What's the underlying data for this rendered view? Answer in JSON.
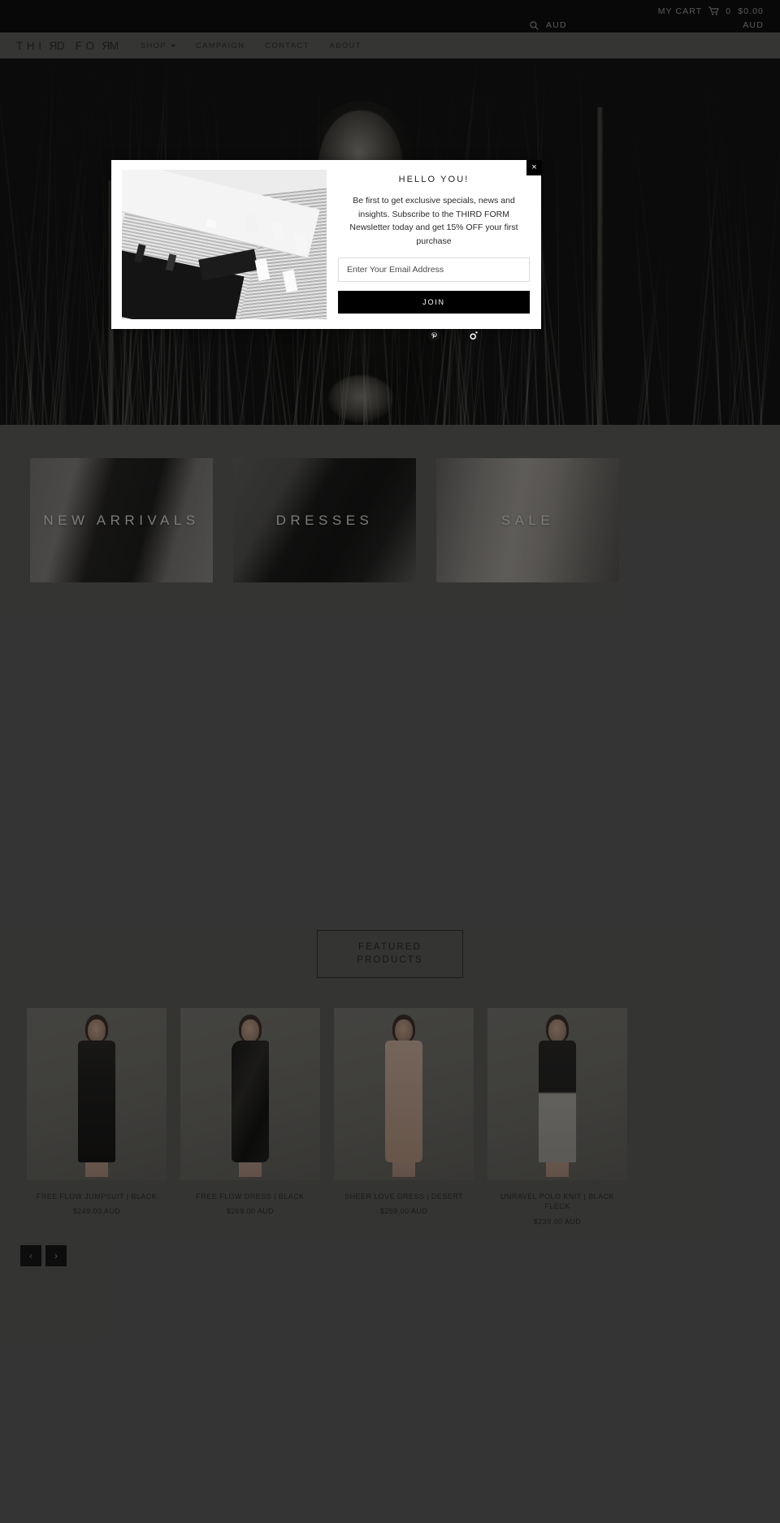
{
  "topbar": {
    "my_cart": "MY CART",
    "cart_icon": "shopping-cart-icon",
    "cart_count": "0",
    "cart_total": "$0.00",
    "search_icon": "search-icon",
    "currency_left": "AUD",
    "currency_right": "AUD"
  },
  "header": {
    "logo": "THIRD FORM",
    "logo_part_1": "THI",
    "logo_flip_1": "R",
    "logo_part_2": "D FO",
    "logo_flip_2": "R",
    "logo_part_3": "M",
    "nav": [
      {
        "label": "SHOP",
        "has_caret": true
      },
      {
        "label": "CAMPAIGN",
        "has_caret": false
      },
      {
        "label": "CONTACT",
        "has_caret": false
      },
      {
        "label": "ABOUT",
        "has_caret": false
      }
    ]
  },
  "categories": [
    {
      "label": "NEW ARRIVALS"
    },
    {
      "label": "DRESSES"
    },
    {
      "label": "SALE"
    }
  ],
  "featured": {
    "line1": "FEATURED",
    "line2": "PRODUCTS",
    "prev_arrow": "‹",
    "next_arrow": "›"
  },
  "products": [
    {
      "title": "FREE FLOW JUMPSUIT | BLACK",
      "price": "$249.00 AUD"
    },
    {
      "title": "FREE FLOW DRESS | BLACK",
      "price": "$269.00 AUD"
    },
    {
      "title": "SHEER LOVE DRESS | DESERT",
      "price": "$259.00 AUD"
    },
    {
      "title": "UNRAVEL POLO KNIT | BLACK FLECK",
      "price": "$239.00 AUD"
    }
  ],
  "modal": {
    "title": "HELLO YOU!",
    "body": "Be first to get exclusive specials, news and insights. Subscribe to the THIRD FORM Newsletter today and get 15% OFF your first purchase",
    "email_placeholder": "Enter Your Email Address",
    "email_value": "",
    "join_label": "JOIN",
    "close_label": "×",
    "social": [
      {
        "name": "facebook-icon"
      },
      {
        "name": "pinterest-icon"
      },
      {
        "name": "instagram-icon"
      }
    ]
  },
  "colors": {
    "page_bg": "#5a5a59",
    "topbar_bg": "#0e0e0e",
    "header_bg": "#5c5c5b",
    "accent_black": "#000000",
    "muted_text": "#9c9c9c"
  }
}
